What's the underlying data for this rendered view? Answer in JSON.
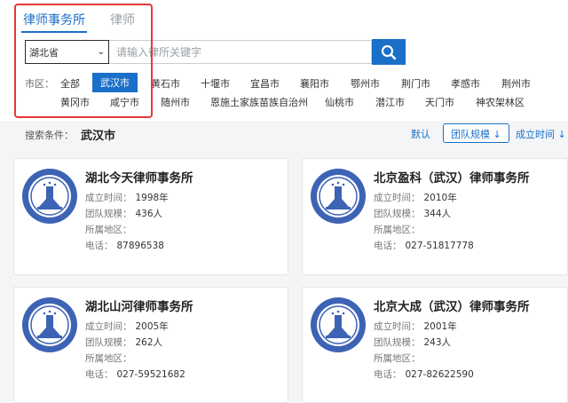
{
  "tabs": [
    {
      "label": "律师事务所",
      "active": true
    },
    {
      "label": "律师",
      "active": false
    }
  ],
  "search": {
    "province": "湖北省",
    "placeholder": "请输入律所关键字"
  },
  "district": {
    "label": "市区：",
    "cities": [
      "全部",
      "武汉市",
      "黄石市",
      "十堰市",
      "宜昌市",
      "襄阳市",
      "鄂州市",
      "荆门市",
      "孝感市",
      "荆州市",
      "黄冈市",
      "咸宁市",
      "随州市",
      "恩施土家族苗族自治州",
      "仙桃市",
      "潜江市",
      "天门市",
      "神农架林区"
    ],
    "active": "武汉市"
  },
  "filter": {
    "label": "搜索条件：",
    "value": "武汉市",
    "sort_default": "默认",
    "sort_team": "团队规模 ↓",
    "sort_year": "成立时间 ↓"
  },
  "field_labels": {
    "founded": "成立时间：",
    "team": "团队规模：",
    "area": "所属地区：",
    "phone": "电话："
  },
  "firms": [
    {
      "name": "湖北今天律师事务所",
      "founded": "1998年",
      "team": "436人",
      "area": "",
      "phone": "87896538"
    },
    {
      "name": "北京盈科（武汉）律师事务所",
      "founded": "2010年",
      "team": "344人",
      "area": "",
      "phone": "027-51817778"
    },
    {
      "name": "湖北山河律师事务所",
      "founded": "2005年",
      "team": "262人",
      "area": "",
      "phone": "027-59521682"
    },
    {
      "name": "北京大成（武汉）律师事务所",
      "founded": "2001年",
      "team": "243人",
      "area": "",
      "phone": "027-82622590"
    }
  ],
  "colors": {
    "accent": "#1a6fc9",
    "highlight_box": "#e53935"
  }
}
